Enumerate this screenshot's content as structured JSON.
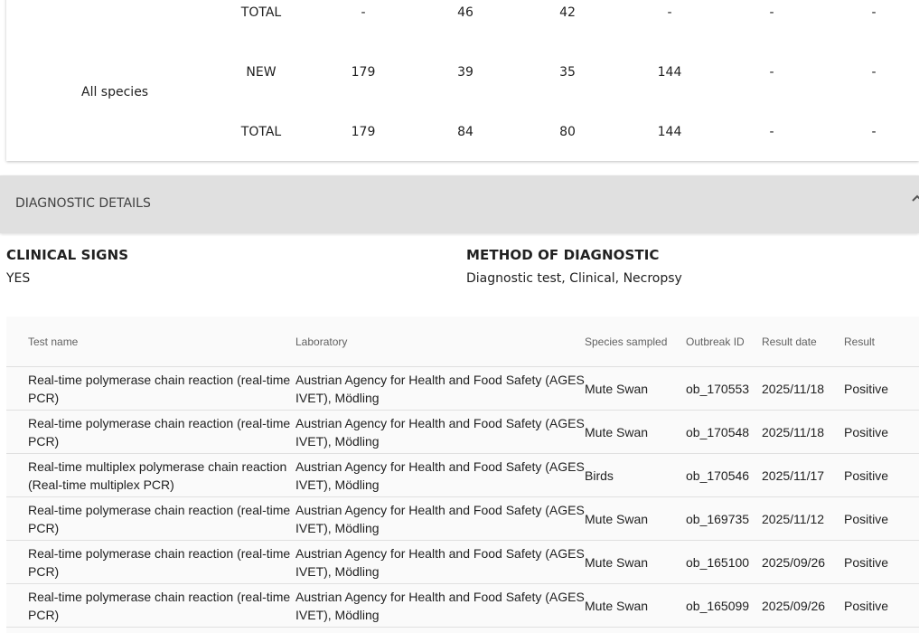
{
  "summary": {
    "rows": [
      {
        "type": "TOTAL",
        "values": [
          "-",
          "46",
          "42",
          "-",
          "-",
          "-"
        ]
      },
      {
        "type": "NEW",
        "values": [
          "179",
          "39",
          "35",
          "144",
          "-",
          "-"
        ]
      },
      {
        "type": "TOTAL",
        "values": [
          "179",
          "84",
          "80",
          "144",
          "-",
          "-"
        ]
      }
    ],
    "species_label": "All species"
  },
  "diagnostic": {
    "header": "DIAGNOSTIC DETAILS",
    "clinical_signs_heading": "CLINICAL SIGNS",
    "clinical_signs_value": "YES",
    "method_heading": "METHOD OF DIAGNOSTIC",
    "method_value": "Diagnostic test, Clinical, Necropsy"
  },
  "table": {
    "headers": [
      "Test name",
      "Laboratory",
      "Species sampled",
      "Outbreak ID",
      "Result date",
      "Result"
    ],
    "rows": [
      [
        "Real-time polymerase chain reaction (real-time PCR)",
        "Austrian Agency for Health and Food Safety (AGES IVET), Mödling",
        "Mute Swan",
        "ob_170553",
        "2025/11/18",
        "Positive"
      ],
      [
        "Real-time polymerase chain reaction (real-time PCR)",
        "Austrian Agency for Health and Food Safety (AGES IVET), Mödling",
        "Mute Swan",
        "ob_170548",
        "2025/11/18",
        "Positive"
      ],
      [
        "Real-time multiplex polymerase chain reaction (Real-time multiplex PCR)",
        "Austrian Agency for Health and Food Safety (AGES IVET), Mödling",
        "Birds",
        "ob_170546",
        "2025/11/17",
        "Positive"
      ],
      [
        "Real-time polymerase chain reaction (real-time PCR)",
        "Austrian Agency for Health and Food Safety (AGES IVET), Mödling",
        "Mute Swan",
        "ob_169735",
        "2025/11/12",
        "Positive"
      ],
      [
        "Real-time polymerase chain reaction (real-time PCR)",
        "Austrian Agency for Health and Food Safety (AGES IVET), Mödling",
        "Mute Swan",
        "ob_165100",
        "2025/09/26",
        "Positive"
      ],
      [
        "Real-time polymerase chain reaction (real-time PCR)",
        "Austrian Agency for Health and Food Safety (AGES IVET), Mödling",
        "Mute Swan",
        "ob_165099",
        "2025/09/26",
        "Positive"
      ]
    ]
  }
}
